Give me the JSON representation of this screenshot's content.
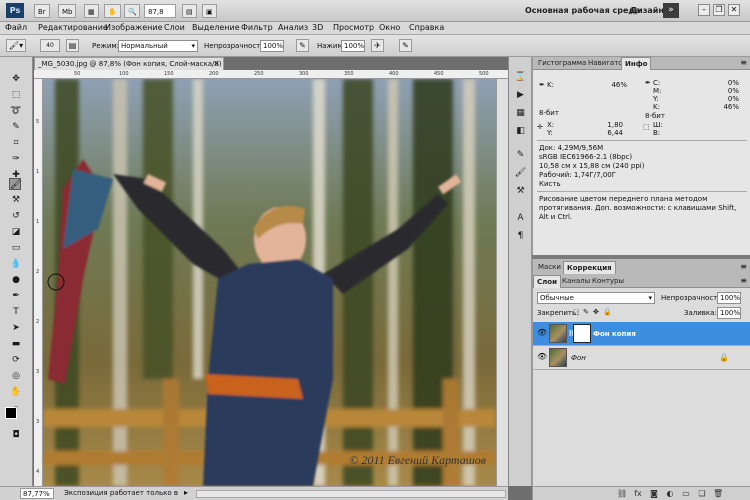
{
  "app": {
    "logo": "Ps",
    "zoom": "87,8",
    "workspace": "Основная рабочая среда",
    "design": "Дизайн",
    "more": "»"
  },
  "menu": [
    "Файл",
    "Редактирование",
    "Изображение",
    "Слои",
    "Выделение",
    "Фильтр",
    "Анализ",
    "3D",
    "Просмотр",
    "Окно",
    "Справка"
  ],
  "options": {
    "brush_size": "40",
    "mode_label": "Режим:",
    "mode_value": "Нормальный",
    "opacity_label": "Непрозрачность:",
    "opacity_value": "100%",
    "flow_label": "Нажим:",
    "flow_value": "100%"
  },
  "document": {
    "tab_title": "_MG_5030.jpg @ 87,8% (Фон копия, Слой-маска/8) *",
    "ruler_h": [
      "50",
      "100",
      "150",
      "200",
      "250",
      "300",
      "350",
      "400",
      "450",
      "500"
    ],
    "ruler_v": [
      "5",
      "1",
      "1",
      "2",
      "2",
      "3",
      "3",
      "4"
    ],
    "watermark": "© 2011 Евгений Карташов"
  },
  "status": {
    "zoom": "87,77%",
    "message": "Экспозиция работает только в ..."
  },
  "info_panel": {
    "tabs": [
      "Гистограмма",
      "Навигатор",
      "Инфо"
    ],
    "active_tab": "Инфо",
    "r1_left_label": "K:",
    "r1_left_value": "46%",
    "r1_right_labels": [
      "C:",
      "M:",
      "Y:",
      "K:"
    ],
    "r1_right_values": [
      "0%",
      "0%",
      "0%",
      "46%"
    ],
    "bit_left": "8-бит",
    "bit_right": "8-бит",
    "xy_labels": [
      "X:",
      "Y:"
    ],
    "xy_values": [
      "1,80",
      "6,44"
    ],
    "wh_labels": [
      "Ш:",
      "В:"
    ],
    "doc_info": [
      "Док: 4,29M/9,56M",
      "sRGB IEC61966-2.1 (8bpc)",
      "10,58 см x 15,88 см (240 ppi)",
      "Рабочий: 1,74Г/7,00Г",
      "Кисть"
    ],
    "hint": "Рисование цветом переднего плана методом протягивания. Доп. возможности: с клавишами Shift, Alt и Ctrl."
  },
  "adjust_panel": {
    "tabs": [
      "Маски",
      "Коррекция"
    ]
  },
  "layers_panel": {
    "tabs": [
      "Слои",
      "Каналы",
      "Контуры"
    ],
    "blend_mode": "Обычные",
    "opacity_label": "Непрозрачность:",
    "opacity_value": "100%",
    "lock_label": "Закрепить:",
    "fill_label": "Заливка:",
    "fill_value": "100%",
    "layers": [
      {
        "name": "Фон копия",
        "selected": true
      },
      {
        "name": "Фон",
        "selected": false
      }
    ]
  }
}
